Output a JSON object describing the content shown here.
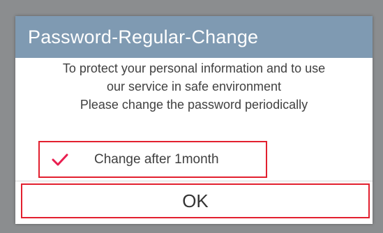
{
  "dialog": {
    "title": "Password-Regular-Change",
    "message_lines": [
      "To protect your personal information and to use",
      "our service in safe environment",
      "Please change the password periodically"
    ],
    "checkbox": {
      "label": "Change after 1month",
      "checked": true,
      "icon": "checkmark-icon"
    },
    "ok_label": "OK"
  },
  "colors": {
    "header_background": "#7f9ab2",
    "highlight_border": "#e2202f",
    "checkmark": "#e91e4f",
    "overlay": "#8b8d8f"
  }
}
